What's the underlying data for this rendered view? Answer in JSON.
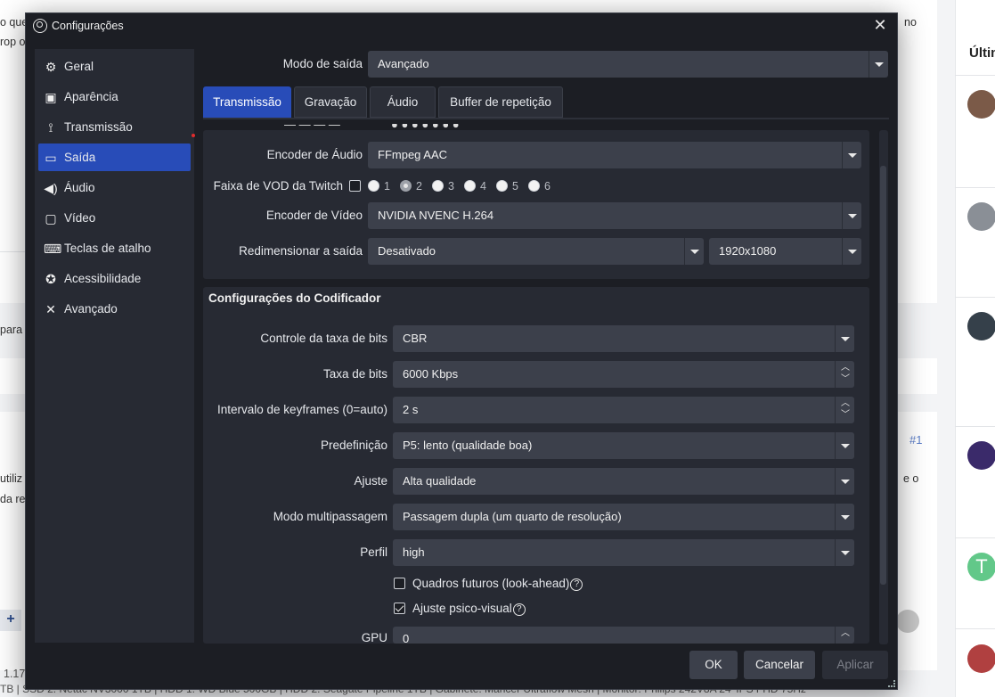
{
  "background": {
    "top_left_text": "o que",
    "top_left_text2": "rop o",
    "top_right_text": "no",
    "para_text": "para",
    "util_text": "utiliz",
    "dare_text": "da re",
    "eo_text": "e o",
    "post_number": "#1",
    "sidebar_heading": "Últim",
    "avatar_letter": "T",
    "bottom_text": "1.17",
    "footer_text": "TB | SSD 2: Netac NV3000 1TB | HDD 1: WD Blue 500GB | HDD 2: Seagate Pipeline 1TB | Gabinete: Mancer Ultraflow Mesh | Monitor: Philips 242V8A 24' IPS FHD 75Hz"
  },
  "dialog": {
    "title": "Configurações",
    "sidebar": {
      "items": [
        {
          "label": "Geral",
          "icon": "gear-icon"
        },
        {
          "label": "Aparência",
          "icon": "palette-icon"
        },
        {
          "label": "Transmissão",
          "icon": "broadcast-icon"
        },
        {
          "label": "Saída",
          "icon": "output-icon"
        },
        {
          "label": "Áudio",
          "icon": "speaker-icon"
        },
        {
          "label": "Vídeo",
          "icon": "monitor-icon"
        },
        {
          "label": "Teclas de atalho",
          "icon": "keyboard-icon"
        },
        {
          "label": "Acessibilidade",
          "icon": "accessibility-icon"
        },
        {
          "label": "Avançado",
          "icon": "tools-icon"
        }
      ],
      "active_index": 3
    },
    "output_mode": {
      "label": "Modo de saída",
      "value": "Avançado"
    },
    "tabs": [
      "Transmissão",
      "Gravação",
      "Áudio",
      "Buffer de repetição"
    ],
    "stream": {
      "audio_encoder": {
        "label": "Encoder de Áudio",
        "value": "FFmpeg AAC"
      },
      "twitch_vod": {
        "label": "Faixa de VOD da Twitch",
        "tracks": [
          "1",
          "2",
          "3",
          "4",
          "5",
          "6"
        ]
      },
      "video_encoder": {
        "label": "Encoder de Vídeo",
        "value": "NVIDIA NVENC H.264"
      },
      "rescale": {
        "label": "Redimensionar a saída",
        "value": "Desativado",
        "resolution": "1920x1080"
      }
    },
    "encoder": {
      "title": "Configurações do Codificador",
      "rate_control": {
        "label": "Controle da taxa de bits",
        "value": "CBR"
      },
      "bitrate": {
        "label": "Taxa de bits",
        "value": "6000 Kbps"
      },
      "keyframe": {
        "label": "Intervalo de keyframes (0=auto)",
        "value": "2 s"
      },
      "preset": {
        "label": "Predefinição",
        "value": "P5: lento (qualidade boa)"
      },
      "tuning": {
        "label": "Ajuste",
        "value": "Alta qualidade"
      },
      "multipass": {
        "label": "Modo multipassagem",
        "value": "Passagem dupla (um quarto de resolução)"
      },
      "profile": {
        "label": "Perfil",
        "value": "high"
      },
      "lookahead": {
        "label": "Quadros futuros (look-ahead)",
        "checked": false
      },
      "psycho": {
        "label": "Ajuste psico-visual",
        "checked": true
      },
      "gpu": {
        "label": "GPU",
        "value": "0"
      }
    },
    "buttons": {
      "ok": "OK",
      "cancel": "Cancelar",
      "apply": "Aplicar"
    },
    "help_mark": "?"
  }
}
